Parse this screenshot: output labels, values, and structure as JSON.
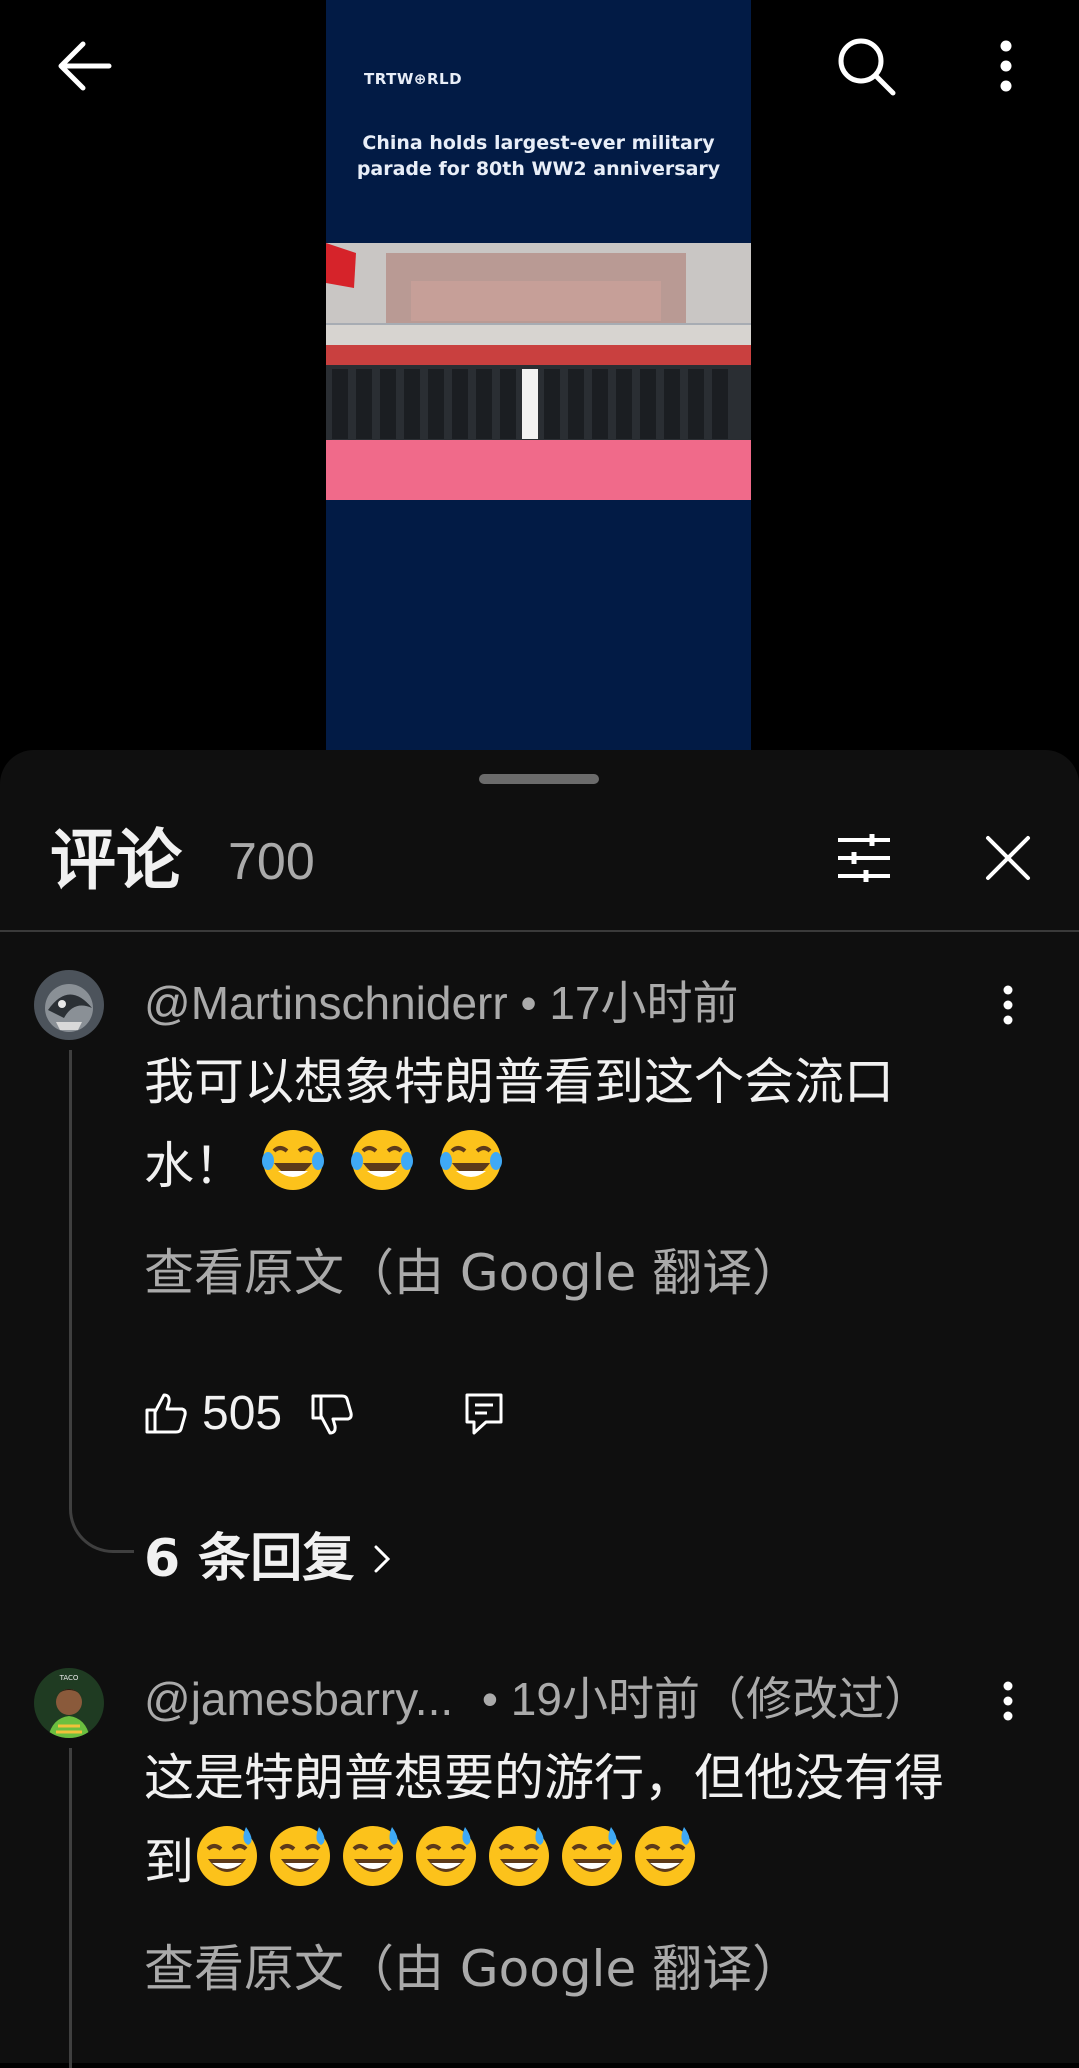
{
  "video": {
    "brand": "TRTW⊕RLD",
    "headline": "China holds largest-ever military parade for 80th WW2 anniversary"
  },
  "comments_panel": {
    "title": "评论",
    "count": "700"
  },
  "comments": [
    {
      "author": "@Martinschniderr",
      "time": "• 17小时前",
      "text": "我可以想象特朗普看到这个会流口水！",
      "emojis": [
        "tears-of-joy",
        "tears-of-joy",
        "tears-of-joy"
      ],
      "translate_link": "查看原文（由 Google 翻译）",
      "likes": "505",
      "replies": "6 条回复"
    },
    {
      "author": "@jamesbarry...",
      "time": "• 19小时前（修改过）",
      "text": "这是特朗普想要的游行，但他没有得到",
      "emojis": [
        "sweat-smile",
        "sweat-smile",
        "sweat-smile",
        "sweat-smile",
        "sweat-smile",
        "sweat-smile",
        "sweat-smile"
      ],
      "translate_link": "查看原文（由 Google 翻译）"
    }
  ],
  "colors": {
    "background": "#000000",
    "sheet": "#0f0f0f",
    "text_primary": "#f1f1f1",
    "text_secondary": "#aaaaaa",
    "video_bg": "#021b45"
  }
}
